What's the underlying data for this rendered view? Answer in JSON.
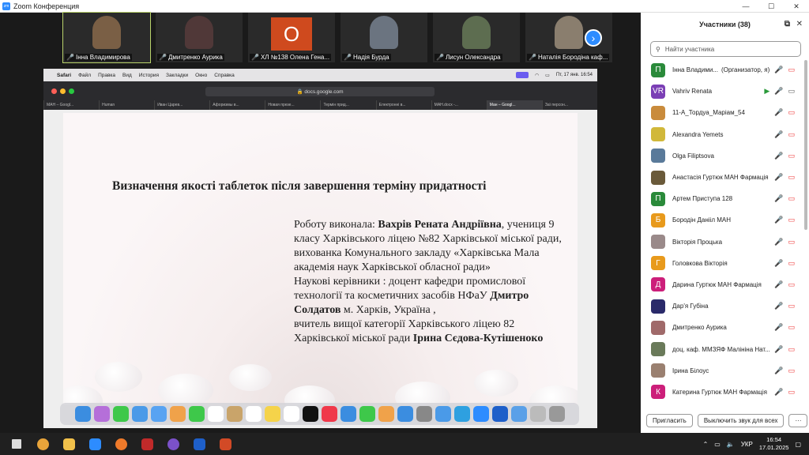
{
  "window": {
    "title": "Zoom Конференция"
  },
  "thumbnails": [
    {
      "name": "Інна Владимирова",
      "color": "#7a5f45",
      "active": true
    },
    {
      "name": "Дмитренко Аурика",
      "color": "#503838"
    },
    {
      "name": "ХЛ №138 Олена Гена...",
      "letter": "О"
    },
    {
      "name": "Надія Бурда",
      "color": "#6b7480"
    },
    {
      "name": "Лисун Олександра",
      "color": "#5d6d50"
    },
    {
      "name": "Наталія Бородіна каф...",
      "color": "#8a7e6e"
    }
  ],
  "mac_menu": {
    "apple": "",
    "app": "Safari",
    "items": [
      "Файл",
      "Правка",
      "Вид",
      "История",
      "Закладки",
      "Окно",
      "Справка"
    ],
    "datetime": "Пт, 17 янв.  16:54"
  },
  "browser": {
    "url": "docs.google.com",
    "tabs": [
      "МАН – Googl...",
      "Human",
      "Иван Царев...",
      "Афоризмы в...",
      "Новая презе...",
      "Термін прид...",
      "Електронні в...",
      "МАН.docx -...",
      "Ман – Googl...",
      "Заї персон..."
    ]
  },
  "slide": {
    "title": "Визначення якості таблеток після завершення терміну придатності",
    "line1a": "Роботу виконала: ",
    "line1b": "Вахрів Рената Андріївна",
    "line2": "учениця 9 класу Харківського  ліцею №82 Харківської міської ради, вихованка Комунального закладу «Харківська Мала академія наук Харківської обласної ради»",
    "line3a": "Наукові керівники : доцент кафедри промислової технології та косметичних засобів НФаУ ",
    "line3b": "Дмитро Солдатов",
    "line3c": " м. Харків, Україна ,",
    "line4a": "вчитель вищої категорії Харківського ліцею 82 Харківської міської ради ",
    "line4b": "Ірина Сєдова-Кутішеноко"
  },
  "panel": {
    "title": "Участники (38)",
    "search_placeholder": "Найти участника",
    "participants": [
      {
        "initial": "П",
        "color": "#2a8a3a",
        "name": "Інна Владими...",
        "role": "(Организатор, я)"
      },
      {
        "initial": "VR",
        "color": "#7b3fb5",
        "name": "Vahriv Renata",
        "video_on": true
      },
      {
        "initial": "",
        "color": "#c98b3c",
        "name": "11-А_Тордуа_Маріам_54"
      },
      {
        "initial": "",
        "color": "#d1b83a",
        "name": "Alexandra Yemets"
      },
      {
        "initial": "",
        "color": "#5a7a9a",
        "name": "Olga Filiptsova"
      },
      {
        "initial": "",
        "color": "#6a5a3a",
        "name": "Анастасія Гуртюк МАН Фармація"
      },
      {
        "initial": "П",
        "color": "#2a8a3a",
        "name": "Артем Приступа 128"
      },
      {
        "initial": "Б",
        "color": "#e89a1c",
        "name": "Бородін Данііл МАН"
      },
      {
        "initial": "",
        "color": "#9a8a8a",
        "name": "Вікторія Процька"
      },
      {
        "initial": "Г",
        "color": "#e89a1c",
        "name": "Головкова Вікторія"
      },
      {
        "initial": "Д",
        "color": "#cc1f7a",
        "name": "Дарина Гуртюк МАН Фармація"
      },
      {
        "initial": "",
        "color": "#2a2a6a",
        "name": "Дар'я Губіна"
      },
      {
        "initial": "",
        "color": "#a06a6a",
        "name": "Дмитренко Аурика"
      },
      {
        "initial": "",
        "color": "#6a7a5a",
        "name": "доц. каф. ММЗЯФ Малініна Нат..."
      },
      {
        "initial": "",
        "color": "#9a8070",
        "name": "Ірина Білоус"
      },
      {
        "initial": "К",
        "color": "#cc1f7a",
        "name": "Катерина Гуртюк МАН Фармація"
      }
    ],
    "invite_label": "Пригласить",
    "mute_all_label": "Выключить звук для всех",
    "more_label": "···"
  },
  "taskbar": {
    "lang": "УКР",
    "time": "16:54",
    "date": "17.01.2025"
  }
}
